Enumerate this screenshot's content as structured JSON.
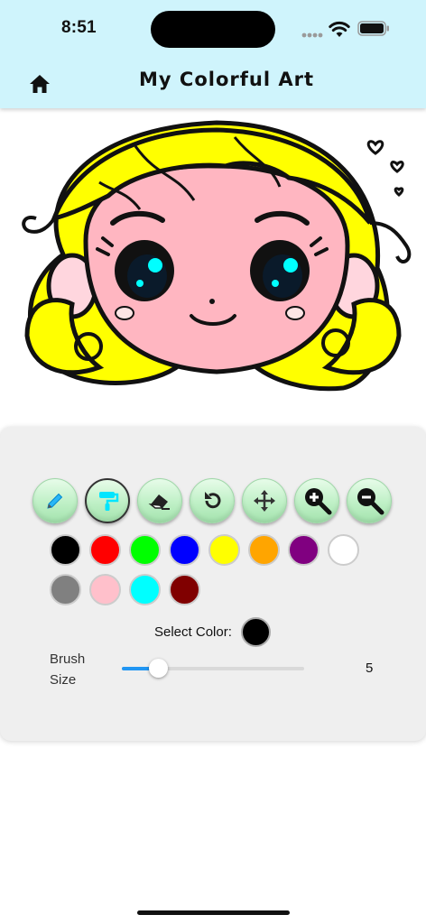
{
  "status_bar": {
    "time": "8:51"
  },
  "header": {
    "title": "My Colorful Art",
    "home_icon": "home-icon",
    "background": "#cff4fc"
  },
  "drawing": {
    "subject": "coloring page of girl face",
    "hair_fill": "#ffff00",
    "skin_fill": "#ffb6c1",
    "eye_color": "#00ffff"
  },
  "tools": [
    {
      "name": "pencil-tool",
      "icon": "pencil-icon",
      "active": false
    },
    {
      "name": "fill-tool",
      "icon": "paint-roller-icon",
      "active": true
    },
    {
      "name": "eraser-tool",
      "icon": "eraser-icon",
      "active": false
    },
    {
      "name": "undo-tool",
      "icon": "undo-icon",
      "active": false
    },
    {
      "name": "move-tool",
      "icon": "move-arrows-icon",
      "active": false
    },
    {
      "name": "zoom-in-tool",
      "icon": "zoom-in-icon",
      "active": false
    },
    {
      "name": "zoom-out-tool",
      "icon": "zoom-out-icon",
      "active": false
    }
  ],
  "palette": [
    "#000000",
    "#ff0000",
    "#00ff00",
    "#0000ff",
    "#ffff00",
    "#ffa500",
    "#800080",
    "#ffffff",
    "#808080",
    "#ffc0cb",
    "#00ffff",
    "#800000"
  ],
  "color_picker": {
    "label": "Select Color:",
    "current": "#000000"
  },
  "brush": {
    "label": "Brush Size",
    "value": "5",
    "fraction": 0.2
  },
  "colors": {
    "tool_button": "#bff0c6",
    "slider_active": "#2196f3",
    "panel_bg": "#efefef"
  }
}
